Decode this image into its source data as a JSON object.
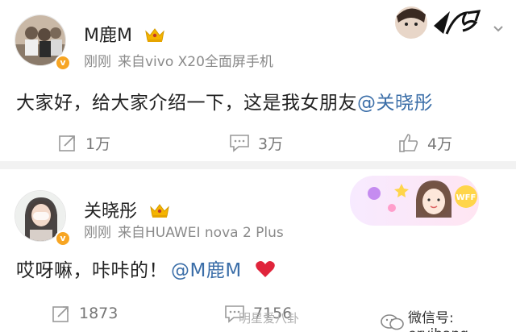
{
  "post1": {
    "username": "M鹿M",
    "time": "刚刚",
    "source": "来自vivo X20全面屏手机",
    "content_text": "大家好，给大家介绍一下，这是我女朋友",
    "content_mention": "@关晓彤",
    "repost_count": "1万",
    "comment_count": "3万",
    "like_count": "4万",
    "vbadge": "v"
  },
  "post2": {
    "username": "关晓彤",
    "time": "刚刚",
    "source": "来自HUAWEI nova 2 Plus",
    "content_text": "哎呀嘛，咔咔的！",
    "content_mention": "@M鹿M",
    "repost_count": "1873",
    "comment_count": "7156",
    "vbadge": "v",
    "badge_text": "WFF"
  },
  "watermark": "明星爱八卦",
  "footer_wechat": "微信号: eryibang",
  "colors": {
    "accent_link": "#3b6ea8",
    "meta_gray": "#8a8a8a",
    "vip_badge": "#f7a523",
    "crown_gold": "#f5b400",
    "heart_red": "#e0243b"
  },
  "icons": [
    "crown-icon",
    "repost-icon",
    "comment-icon",
    "like-icon",
    "heart-icon",
    "more-icon",
    "wechat-icon"
  ]
}
